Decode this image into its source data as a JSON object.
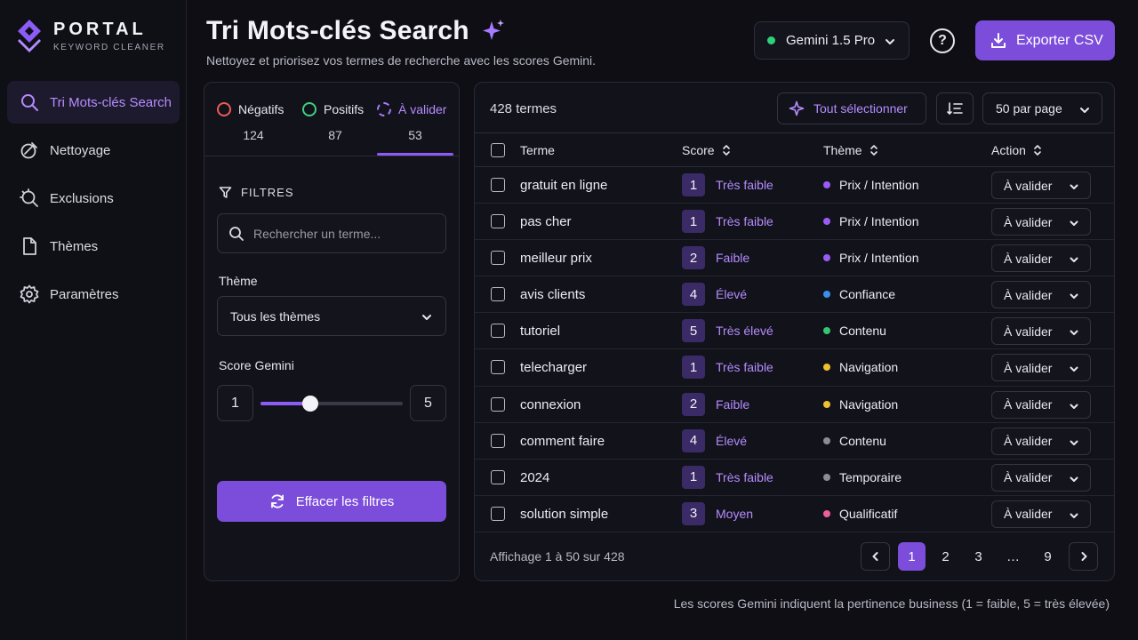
{
  "brand": {
    "name": "PORTAL",
    "subtitle": "KEYWORD CLEANER",
    "logo_icon": "diamond-logo-icon"
  },
  "nav": [
    {
      "label": "Tri Mots-clés Search",
      "icon": "search-icon",
      "active": true
    },
    {
      "label": "Nettoyage",
      "icon": "broom-icon",
      "active": false
    },
    {
      "label": "Exclusions",
      "icon": "exclusion-icon",
      "active": false
    },
    {
      "label": "Thèmes",
      "icon": "document-icon",
      "active": false
    },
    {
      "label": "Paramètres",
      "icon": "gear-icon",
      "active": false
    }
  ],
  "header": {
    "title": "Tri Mots-clés Search",
    "subtitle": "Nettoyez et priorisez vos termes de recherche avec les scores Gemini.",
    "model": "Gemini 1.5 Pro",
    "model_status_color": "#2fd07a",
    "help_label": "?",
    "export_label": "Exporter CSV"
  },
  "tabs": [
    {
      "label": "Négatifs",
      "count": "124",
      "color": "#ef5a5a"
    },
    {
      "label": "Positifs",
      "count": "87",
      "color": "#3fcf7f"
    },
    {
      "label": "À valider",
      "count": "53",
      "color": "#a77bff",
      "active": true
    }
  ],
  "filters": {
    "heading": "FILTRES",
    "search_placeholder": "Rechercher un terme...",
    "theme_label": "Thème",
    "theme_value": "Tous les thèmes",
    "score_label": "Score Gemini",
    "score_min": "1",
    "score_max": "5",
    "score_slider_value": 2.4,
    "clear_label": "Effacer les filtres"
  },
  "table": {
    "count_label": "428 termes",
    "select_all_label": "Tout sélectionner",
    "per_page_label": "50 par page",
    "columns": {
      "term": "Terme",
      "score": "Score",
      "theme": "Thème",
      "action": "Action"
    },
    "rows": [
      {
        "term": "gratuit en ligne",
        "score": "1",
        "score_label": "Très faible",
        "theme": "Prix / Intention",
        "theme_color": "#9b5cf6",
        "action": "À valider"
      },
      {
        "term": "pas cher",
        "score": "1",
        "score_label": "Très faible",
        "theme": "Prix / Intention",
        "theme_color": "#9b5cf6",
        "action": "À valider"
      },
      {
        "term": "meilleur prix",
        "score": "2",
        "score_label": "Faible",
        "theme": "Prix / Intention",
        "theme_color": "#9b5cf6",
        "action": "À valider"
      },
      {
        "term": "avis clients",
        "score": "4",
        "score_label": "Élevé",
        "theme": "Confiance",
        "theme_color": "#3b8ef0",
        "action": "À valider"
      },
      {
        "term": "tutoriel",
        "score": "5",
        "score_label": "Très élevé",
        "theme": "Contenu",
        "theme_color": "#34c76f",
        "action": "À valider"
      },
      {
        "term": "telecharger",
        "score": "1",
        "score_label": "Très faible",
        "theme": "Navigation",
        "theme_color": "#f0c02e",
        "action": "À valider"
      },
      {
        "term": "connexion",
        "score": "2",
        "score_label": "Faible",
        "theme": "Navigation",
        "theme_color": "#f0c02e",
        "action": "À valider"
      },
      {
        "term": "comment faire",
        "score": "4",
        "score_label": "Élevé",
        "theme": "Contenu",
        "theme_color": "#8c8c98",
        "action": "À valider"
      },
      {
        "term": "2024",
        "score": "1",
        "score_label": "Très faible",
        "theme": "Temporaire",
        "theme_color": "#8c8c98",
        "action": "À valider"
      },
      {
        "term": "solution simple",
        "score": "3",
        "score_label": "Moyen",
        "theme": "Qualificatif",
        "theme_color": "#ec5f9e",
        "action": "À valider"
      }
    ],
    "footer_info": "Affichage 1 à 50 sur 428",
    "pages": [
      "1",
      "2",
      "3",
      "…",
      "9"
    ],
    "current_page": "1"
  },
  "note": "Les scores Gemini indiquent la pertinence business (1 = faible, 5 = très élevée)"
}
